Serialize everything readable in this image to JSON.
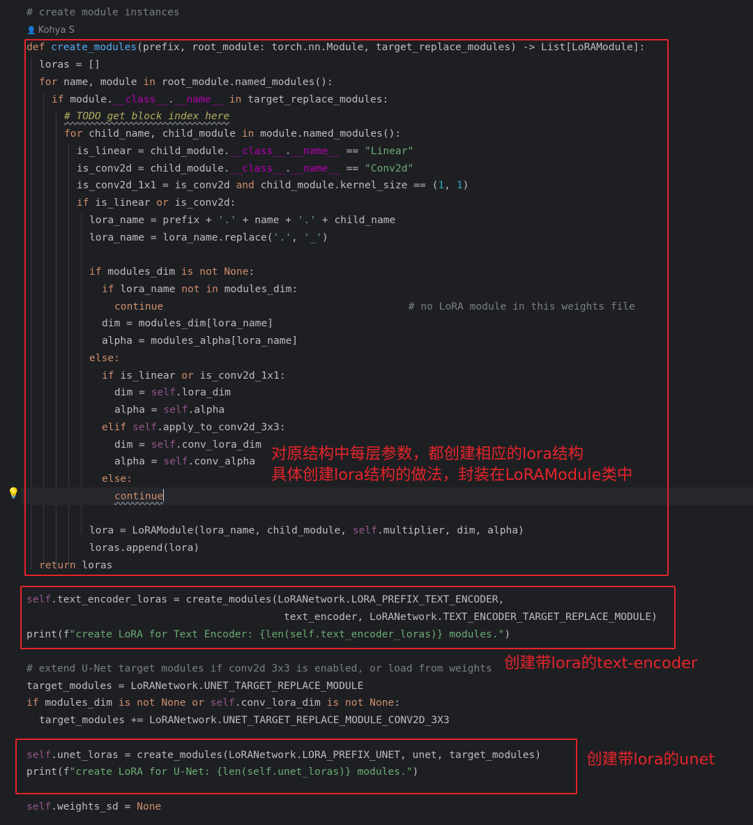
{
  "editor": {
    "author": "Kohya S",
    "author_icon": "user-icon",
    "gutter_icon": "lightbulb-icon",
    "lines": {
      "l0": "# create module instances",
      "l2": "def create_modules(prefix, root_module: torch.nn.Module, target_replace_modules) -> List[LoRAModule]:",
      "l3": "loras = []",
      "l4": "for name, module in root_module.named_modules():",
      "l5": "if module.__class__.__name__ in target_replace_modules:",
      "l6": "# TODO get block index here",
      "l7": "for child_name, child_module in module.named_modules():",
      "l8": "is_linear = child_module.__class__.__name__ == \"Linear\"",
      "l9": "is_conv2d = child_module.__class__.__name__ == \"Conv2d\"",
      "l10": "is_conv2d_1x1 = is_conv2d and child_module.kernel_size == (1, 1)",
      "l11": "if is_linear or is_conv2d:",
      "l12": "lora_name = prefix + '.' + name + '.' + child_name",
      "l13": "lora_name = lora_name.replace('.', '_')",
      "l15": "if modules_dim is not None:",
      "l16": "if lora_name not in modules_dim:",
      "l17": "continue                                        # no LoRA module in this weights file",
      "l18": "dim = modules_dim[lora_name]",
      "l19": "alpha = modules_alpha[lora_name]",
      "l20": "else:",
      "l21": "if is_linear or is_conv2d_1x1:",
      "l22": "dim = self.lora_dim",
      "l23": "alpha = self.alpha",
      "l24": "elif self.apply_to_conv2d_3x3:",
      "l25": "dim = self.conv_lora_dim",
      "l26": "alpha = self.conv_alpha",
      "l27": "else:",
      "l28": "continue",
      "l30": "lora = LoRAModule(lora_name, child_module, self.multiplier, dim, alpha)",
      "l31": "loras.append(lora)",
      "l32": "return loras",
      "l34": "self.text_encoder_loras = create_modules(LoRANetwork.LORA_PREFIX_TEXT_ENCODER,",
      "l35": "text_encoder, LoRANetwork.TEXT_ENCODER_TARGET_REPLACE_MODULE)",
      "l36": "print(f\"create LoRA for Text Encoder: {len(self.text_encoder_loras)} modules.\")",
      "l38": "# extend U-Net target modules if conv2d 3x3 is enabled, or load from weights",
      "l39": "target_modules = LoRANetwork.UNET_TARGET_REPLACE_MODULE",
      "l40": "if modules_dim is not None or self.conv_lora_dim is not None:",
      "l41": "target_modules += LoRANetwork.UNET_TARGET_REPLACE_MODULE_CONV2D_3X3",
      "l43": "self.unet_loras = create_modules(LoRANetwork.LORA_PREFIX_UNET, unet, target_modules)",
      "l44": "print(f\"create LoRA for U-Net: {len(self.unet_loras)} modules.\")",
      "l46": "self.weights_sd = None"
    }
  },
  "annotations": {
    "create_modules_note_line1": "对原结构中每层参数，都创建相应的lora结构",
    "create_modules_note_line2": "具体创建lora结构的做法，封装在LoRAModule类中",
    "text_encoder_note": "创建带lora的text-encoder",
    "unet_note": "创建带lora的unet"
  },
  "colors": {
    "background": "#1e1f22",
    "annotation_red": "#e5242b",
    "keyword": "#cf8e6d",
    "self": "#94558d",
    "string": "#6aab73",
    "comment": "#7a7e85"
  }
}
